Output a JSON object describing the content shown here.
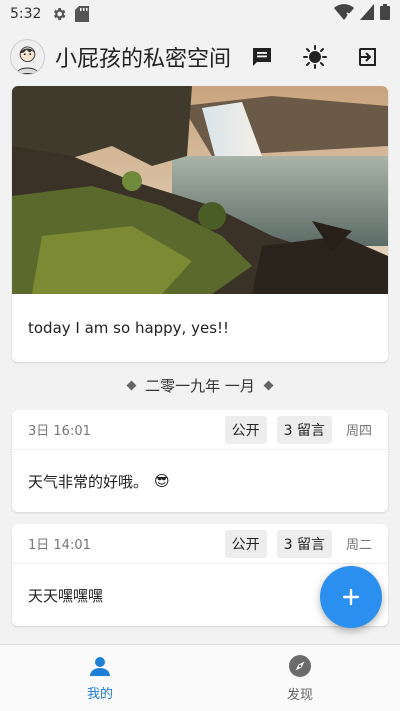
{
  "status_bar": {
    "time": "5:32"
  },
  "app_bar": {
    "title": "小屁孩的私密空间"
  },
  "hero": {
    "text": "today  I am so happy, yes!!"
  },
  "month_divider": {
    "label": "二零一九年 一月"
  },
  "entries": [
    {
      "date": "3日 16:01",
      "visibility": "公开",
      "comments": "3 留言",
      "weekday": "周四",
      "text": "天气非常的好哦。",
      "emoji": "😎"
    },
    {
      "date": "1日 14:01",
      "visibility": "公开",
      "comments": "3 留言",
      "weekday": "周二",
      "text": "天天嘿嘿嘿"
    }
  ],
  "bottom_nav": [
    {
      "label": "我的",
      "icon": "person-icon",
      "active": true
    },
    {
      "label": "发现",
      "icon": "compass-icon",
      "active": false
    }
  ],
  "colors": {
    "accent": "#2b8ff0",
    "nav_active": "#1f7fd6"
  }
}
